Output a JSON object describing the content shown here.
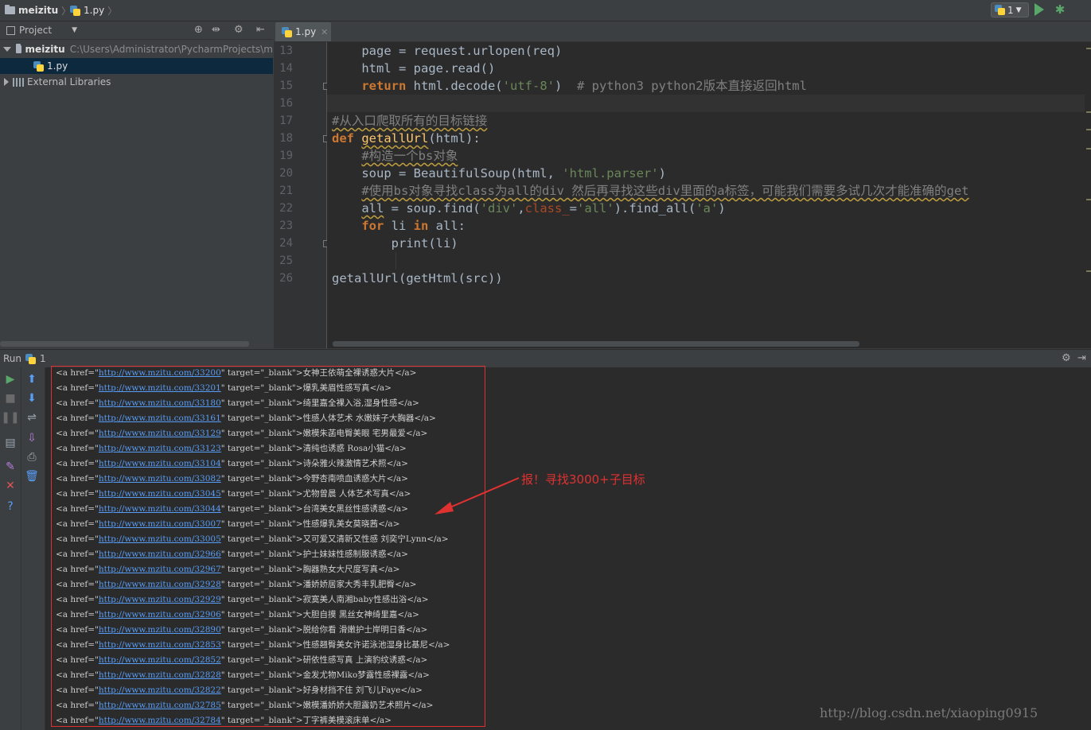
{
  "navbar": {
    "project_name": "meizitu",
    "file_name": "1.py",
    "run_config": "1"
  },
  "project_panel": {
    "title": "Project",
    "root_name": "meizitu",
    "root_path": "C:\\Users\\Administrator\\PycharmProjects\\m",
    "file_item": "1.py",
    "external": "External Libraries"
  },
  "editor": {
    "tab_label": "1.py",
    "line_numbers": [
      "13",
      "14",
      "15",
      "16",
      "17",
      "18",
      "19",
      "20",
      "21",
      "22",
      "23",
      "24",
      "25",
      "26"
    ]
  },
  "run_panel": {
    "title": "Run",
    "config": "1"
  },
  "console": {
    "lines": [
      {
        "href": "http://www.mzitu.com/33200",
        "text": "女神王依萌全裸诱惑大片"
      },
      {
        "href": "http://www.mzitu.com/33201",
        "text": "爆乳美眉性感写真"
      },
      {
        "href": "http://www.mzitu.com/33180",
        "text": "绮里嘉全裸入浴,湿身性感"
      },
      {
        "href": "http://www.mzitu.com/33161",
        "text": "性感人体艺术 水嫩妹子大胸器"
      },
      {
        "href": "http://www.mzitu.com/33129",
        "text": "嫩模朱菡电臀美眼 宅男最爱"
      },
      {
        "href": "http://www.mzitu.com/33123",
        "text": "清纯也诱惑 Rosa小猫"
      },
      {
        "href": "http://www.mzitu.com/33104",
        "text": "诗朵雅火辣激情艺术照"
      },
      {
        "href": "http://www.mzitu.com/33082",
        "text": "今野杏南喷血诱惑大片"
      },
      {
        "href": "http://www.mzitu.com/33045",
        "text": "尤物曾晨 人体艺术写真"
      },
      {
        "href": "http://www.mzitu.com/33044",
        "text": "台湾美女黑丝性感诱惑"
      },
      {
        "href": "http://www.mzitu.com/33007",
        "text": "性感爆乳美女莫晓茜"
      },
      {
        "href": "http://www.mzitu.com/33005",
        "text": "又可爱又清新又性感 刘奕宁Lynn"
      },
      {
        "href": "http://www.mzitu.com/32966",
        "text": "护士妹妹性感制服诱惑"
      },
      {
        "href": "http://www.mzitu.com/32967",
        "text": "胸器熟女大尺度写真"
      },
      {
        "href": "http://www.mzitu.com/32928",
        "text": "潘娇娇居家大秀丰乳肥臀"
      },
      {
        "href": "http://www.mzitu.com/32929",
        "text": "寂寞美人南湘baby性感出浴"
      },
      {
        "href": "http://www.mzitu.com/32906",
        "text": "大胆自摸 黑丝女神绮里嘉"
      },
      {
        "href": "http://www.mzitu.com/32890",
        "text": "脱给你看 滑嫩护士岸明日香"
      },
      {
        "href": "http://www.mzitu.com/32853",
        "text": "性感翘臀美女许诺泳池湿身比基尼"
      },
      {
        "href": "http://www.mzitu.com/32852",
        "text": "研依性感写真 上演豹纹诱惑"
      },
      {
        "href": "http://www.mzitu.com/32828",
        "text": "金发尤物Miko梦露性感裸露"
      },
      {
        "href": "http://www.mzitu.com/32822",
        "text": "好身材挡不住 刘飞儿Faye"
      },
      {
        "href": "http://www.mzitu.com/32785",
        "text": "嫩模潘娇娇大胆露奶艺术照片"
      },
      {
        "href": "http://www.mzitu.com/32784",
        "text": "丁字裤美模滚床单"
      }
    ],
    "prefix": "<a href=\"",
    "mid": "\" target=\"_blank\">",
    "suffix": "</a>"
  },
  "annotation": "报！寻找3000+子目标",
  "watermark": "http://blog.csdn.net/xiaoping0915"
}
